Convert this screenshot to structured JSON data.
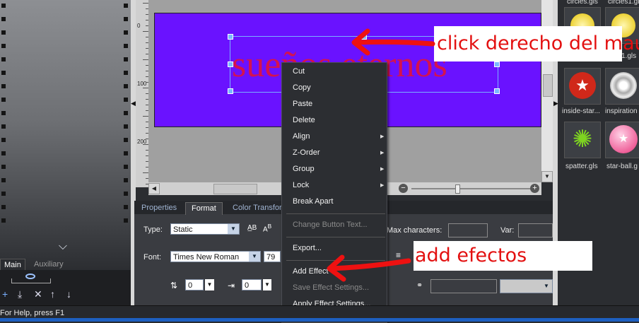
{
  "left_panel": {
    "tabs": [
      "Main",
      "Auxiliary"
    ],
    "toolbar_icons": [
      "add-icon",
      "download-icon",
      "close-icon",
      "move-up-icon",
      "move-down-icon"
    ]
  },
  "ruler": {
    "marks": [
      "0",
      "100",
      "200"
    ]
  },
  "canvas": {
    "text": "sueños eternos",
    "background": "#6a12ff",
    "text_color": "#d4134e"
  },
  "effects_panel": {
    "items": [
      {
        "label": "circles.gls"
      },
      {
        "label": "circles1.gl"
      },
      {
        "label": "s1.gls"
      },
      {
        "label": "inside-star..."
      },
      {
        "label": "inspiration"
      },
      {
        "label": "spatter.gls"
      },
      {
        "label": "star-ball.g"
      }
    ]
  },
  "properties": {
    "tabs": [
      "Properties",
      "Format",
      "Color Transform"
    ],
    "active_tab": "Format",
    "type_label": "Type:",
    "type_value": "Static",
    "font_label": "Font:",
    "font_value": "Times New Roman",
    "font_size": "79",
    "max_chars_label": "Max characters:",
    "var_label": "Var:",
    "spacing_value_1": "0",
    "spacing_value_2": "0"
  },
  "context_menu": {
    "items": [
      {
        "label": "Cut",
        "submenu": false,
        "disabled": false
      },
      {
        "label": "Copy",
        "submenu": false,
        "disabled": false
      },
      {
        "label": "Paste",
        "submenu": false,
        "disabled": false
      },
      {
        "label": "Delete",
        "submenu": false,
        "disabled": false
      },
      {
        "label": "Align",
        "submenu": true,
        "disabled": false
      },
      {
        "label": "Z-Order",
        "submenu": true,
        "disabled": false
      },
      {
        "label": "Group",
        "submenu": true,
        "disabled": false
      },
      {
        "label": "Lock",
        "submenu": true,
        "disabled": false
      },
      {
        "label": "Break Apart",
        "submenu": false,
        "disabled": false
      },
      {
        "label": "Change Button Text...",
        "submenu": false,
        "disabled": true
      },
      {
        "label": "Export...",
        "submenu": false,
        "disabled": false
      },
      {
        "label": "Add Effect",
        "submenu": false,
        "disabled": false
      },
      {
        "label": "Save Effect Settings...",
        "submenu": false,
        "disabled": true
      },
      {
        "label": "Apply Effect Settings...",
        "submenu": false,
        "disabled": false
      }
    ]
  },
  "status_bar": {
    "text": "For Help, press F1"
  },
  "annotations": [
    {
      "text": "click derecho del mau",
      "color": "#e31010"
    },
    {
      "text": "add efectos",
      "color": "#e31010"
    }
  ]
}
